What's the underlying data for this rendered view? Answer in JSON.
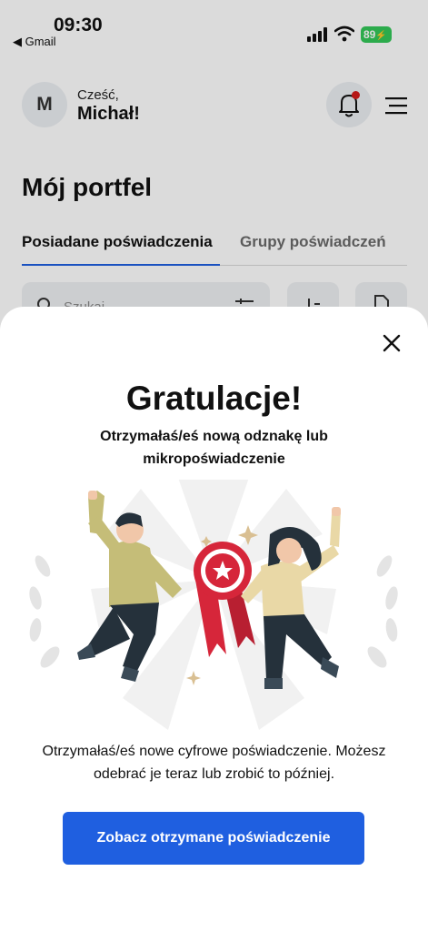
{
  "status_bar": {
    "time": "09:30",
    "back_app": "◀ Gmail",
    "battery": "89"
  },
  "header": {
    "avatar_initial": "M",
    "greeting": "Cześć,",
    "user_name": "Michał!"
  },
  "page": {
    "title": "Mój portfel",
    "tabs": [
      {
        "label": "Posiadane poświadczenia",
        "active": true
      },
      {
        "label": "Grupy poświadczeń",
        "active": false
      }
    ],
    "search_placeholder": "Szukaj"
  },
  "modal": {
    "title": "Gratulacje!",
    "subtitle": "Otrzymałaś/eś nową odznakę lub mikropoświadczenie",
    "body": "Otrzymałaś/eś nowe cyfrowe poświadczenie. Możesz odebrać je teraz lub zrobić to później.",
    "cta_label": "Zobacz otrzymane poświadczenie"
  },
  "colors": {
    "accent": "#1f5fe0",
    "notification_dot": "#d41b1b",
    "battery": "#34c759",
    "ribbon": "#d6263a"
  },
  "icons": [
    "signal-icon",
    "wifi-icon",
    "bell-icon",
    "menu-icon",
    "search-icon",
    "filter-icon",
    "sort-icon",
    "document-icon",
    "close-icon"
  ]
}
